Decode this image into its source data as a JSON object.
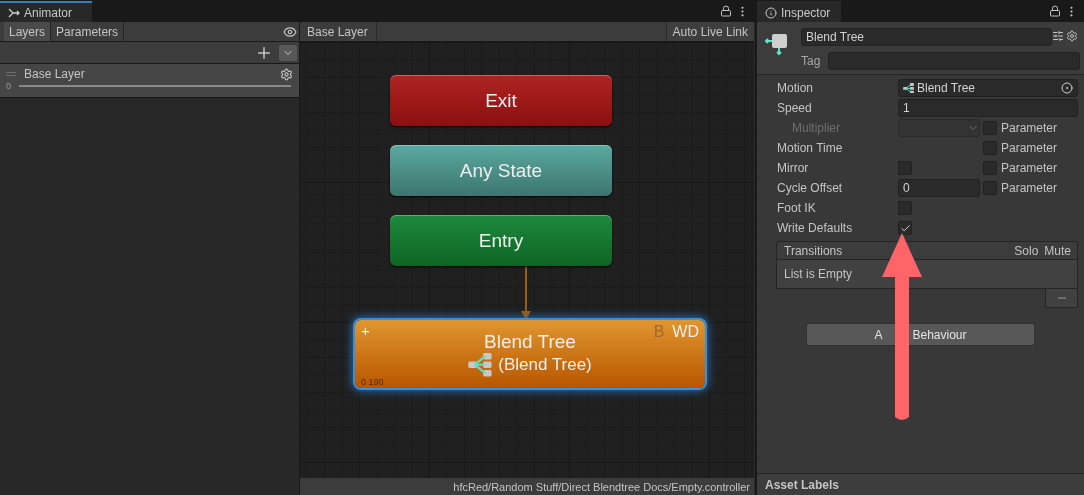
{
  "animator": {
    "tab": "Animator",
    "layer_tabs": [
      {
        "label": "Layers",
        "selected": true
      },
      {
        "label": "Parameters",
        "selected": false
      }
    ],
    "layers": [
      {
        "name": "Base Layer",
        "weight": "0",
        "level": 1
      }
    ],
    "breadcrumb": "Base Layer",
    "live_link": "Auto Live Link",
    "nodes": [
      {
        "kind": "exit",
        "label": "Exit",
        "selected": false
      },
      {
        "kind": "any",
        "label": "Any State",
        "selected": false
      },
      {
        "kind": "entry",
        "label": "Entry",
        "selected": false
      },
      {
        "kind": "blend",
        "label": "Blend Tree",
        "subtitle": "(Blend Tree)",
        "corner": "+",
        "flag_b": "B",
        "flag_wd": "WD",
        "position": "0  190",
        "selected": true
      }
    ],
    "footer": "hfcRed/Random Stuff/Direct Blendtree Docs/Empty.controller"
  },
  "inspector": {
    "tab": "Inspector",
    "name": "Blend Tree",
    "tag_label": "Tag",
    "properties": [
      {
        "kind": "object",
        "label": "Motion",
        "value": "Blend Tree",
        "disabled": false
      },
      {
        "kind": "number",
        "label": "Speed",
        "value": "1",
        "disabled": false
      },
      {
        "kind": "dropdown",
        "label": "Multiplier",
        "disabled": true,
        "parameter": {
          "label": "Parameter",
          "checked": false
        }
      },
      {
        "kind": "none",
        "label": "Motion Time",
        "disabled": false,
        "parameter": {
          "label": "Parameter",
          "checked": false
        }
      },
      {
        "kind": "checkbox",
        "label": "Mirror",
        "checked": false,
        "disabled": false,
        "parameter": {
          "label": "Parameter",
          "checked": false
        }
      },
      {
        "kind": "short",
        "label": "Cycle Offset",
        "value": "0",
        "disabled": false,
        "parameter": {
          "label": "Parameter",
          "checked": false
        }
      },
      {
        "kind": "checkbox",
        "label": "Foot IK",
        "checked": false,
        "disabled": false
      },
      {
        "kind": "checkbox",
        "label": "Write Defaults",
        "checked": true,
        "disabled": false
      }
    ],
    "transitions": {
      "header": "Transitions",
      "solo": "Solo",
      "mute": "Mute",
      "empty": "List is Empty"
    },
    "add_behaviour": {
      "before": "A",
      "after": "Behaviour"
    },
    "asset_labels": "Asset Labels"
  }
}
